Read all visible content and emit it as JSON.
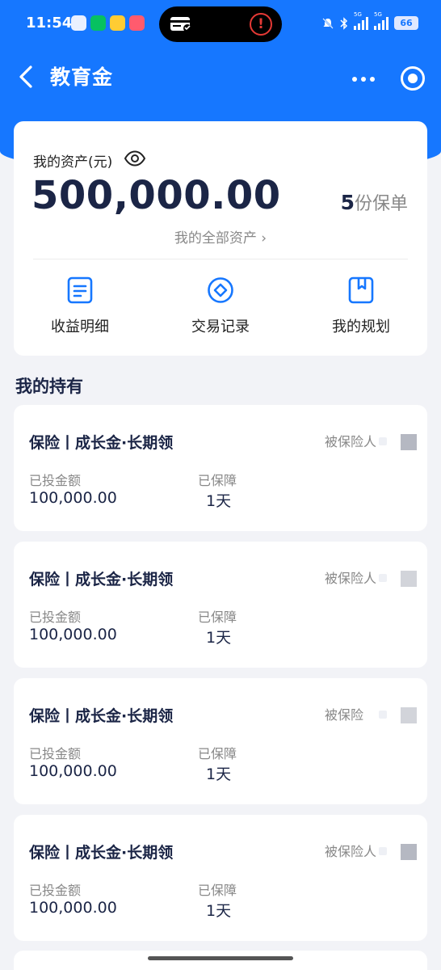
{
  "status_bar": {
    "time": "11:54",
    "alert": "!",
    "network_1": "5G",
    "network_2": "5G",
    "battery": "66"
  },
  "nav": {
    "title": "教育金"
  },
  "assets": {
    "label": "我的资产(元)",
    "amount": "500,000.00",
    "policy_count_num": "5",
    "policy_count_unit": "份保单",
    "all_assets_link": "我的全部资产 ›",
    "quick_actions": [
      {
        "label": "收益明细",
        "icon": "document-icon"
      },
      {
        "label": "交易记录",
        "icon": "diamond-circle-icon"
      },
      {
        "label": "我的规划",
        "icon": "bookmark-book-icon"
      }
    ]
  },
  "holdings": {
    "title": "我的持有",
    "items": [
      {
        "name": "保险丨成长金·长期领",
        "insured": "被保险人",
        "invested_label": "已投金额",
        "invested_value": "100,000.00",
        "covered_label": "已保障",
        "covered_value": "1天"
      },
      {
        "name": "保险丨成长金·长期领",
        "insured": "被保险人",
        "invested_label": "已投金额",
        "invested_value": "100,000.00",
        "covered_label": "已保障",
        "covered_value": "1天"
      },
      {
        "name": "保险丨成长金·长期领",
        "insured": "被保险",
        "invested_label": "已投金额",
        "invested_value": "100,000.00",
        "covered_label": "已保障",
        "covered_value": "1天"
      },
      {
        "name": "保险丨成长金·长期领",
        "insured": "被保险人",
        "invested_label": "已投金额",
        "invested_value": "100,000.00",
        "covered_label": "已保障",
        "covered_value": "1天"
      }
    ]
  },
  "colors": {
    "brand_blue": "#1677ff",
    "navy_text": "#1b2546",
    "muted_text": "#888888",
    "page_bg": "#f2f3f7"
  }
}
